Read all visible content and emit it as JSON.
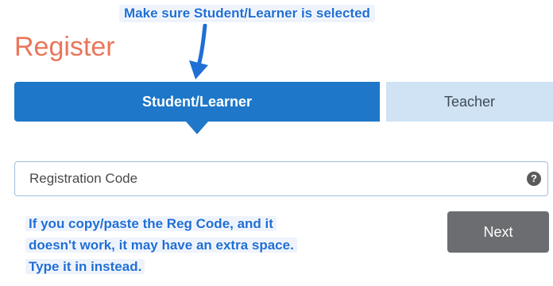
{
  "annotations": {
    "top": "Make sure Student/Learner is selected",
    "bottom_lines": [
      "If you copy/paste the Reg Code, and it",
      "doesn't work, it may have an extra space.",
      "Type it in instead."
    ],
    "color": "#1f6fd6"
  },
  "page": {
    "title": "Register",
    "title_color": "#e9765a"
  },
  "tabs": {
    "student_label": "Student/Learner",
    "teacher_label": "Teacher",
    "selected": "Student/Learner",
    "active_color": "#1e77c8",
    "inactive_color": "#cfe3f5"
  },
  "form": {
    "code_placeholder": "Registration Code",
    "code_value": "",
    "help_icon": "question-circle-icon",
    "help_glyph": "?",
    "next_label": "Next",
    "next_color": "#6b6d70"
  }
}
